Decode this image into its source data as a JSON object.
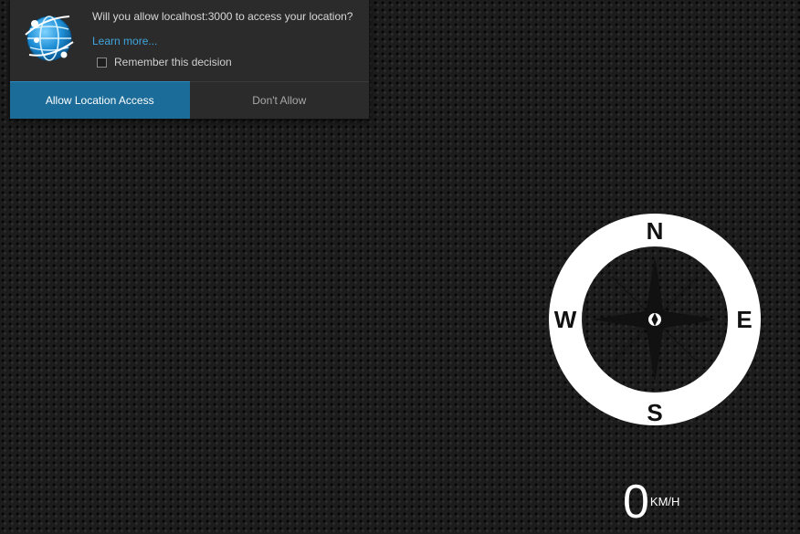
{
  "popup": {
    "question": "Will you allow localhost:3000 to access your location?",
    "learn_more": "Learn more...",
    "remember_label": "Remember this decision",
    "remember_checked": false,
    "allow_button": "Allow Location Access",
    "deny_button": "Don't Allow",
    "icon": "globe-location-icon"
  },
  "compass": {
    "north": "N",
    "south": "S",
    "east": "E",
    "west": "W",
    "icon": "compass-rose-icon"
  },
  "speed": {
    "value": "0",
    "unit": "KM/H"
  },
  "colors": {
    "accent": "#1b6c98",
    "link": "#3fa6dd",
    "background": "#1c1c1c",
    "compass_ring": "#ffffff",
    "compass_rose": "#111111"
  }
}
